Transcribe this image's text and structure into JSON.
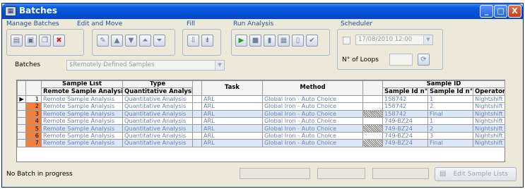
{
  "window": {
    "title": "Batches",
    "controls": [
      "_",
      "□",
      "X"
    ]
  },
  "toolbar": {
    "groups": [
      {
        "label": "Manage Batches",
        "icons": [
          "folder-open-icon",
          "save-icon",
          "copy-icon",
          "delete-icon"
        ]
      },
      {
        "label": "Edit and Move",
        "icons": [
          "edit-icon",
          "move-up-icon",
          "move-down-icon",
          "move-top-icon",
          "move-bottom-icon"
        ]
      },
      {
        "label": "Fill",
        "icons": [
          "fill-down-icon",
          "fill-series-icon"
        ]
      },
      {
        "label": "Run Analysis",
        "icons": [
          "play-icon",
          "stop-icon",
          "pause-icon",
          "multi-page-icon",
          "single-page-icon",
          "checkmark-icon"
        ]
      },
      {
        "label": "Scheduler"
      }
    ],
    "scheduler": {
      "datetime": "17/08/2010 12:00",
      "loops_label": "N° of Loops",
      "loops_value": ""
    }
  },
  "batches": {
    "label": "Batches",
    "value": "$Remotely Defined Samples"
  },
  "grid": {
    "headers": {
      "sample_list": "Sample List",
      "type": "Type",
      "task": "Task",
      "method": "Method",
      "sample_id": "Sample ID",
      "remote_sample_analysis": "Remote Sample Analysis",
      "quantitative_analysis": "Quantitative Analysis",
      "sample_id_n1": "Sample Id n°1",
      "sample_id_n2": "Sample Id n°2",
      "operator": "Operator"
    },
    "rows": [
      {
        "marker": "▶",
        "num": "1",
        "sample_list": "Remote Sample Analysis",
        "type": "Quantitative Analysis",
        "task": "ARL",
        "method": "Global Iron - Auto Choice",
        "hatch": false,
        "id1": "158742",
        "id2": "1",
        "operator": "Nightshift"
      },
      {
        "marker": "",
        "num": "2",
        "sample_list": "Remote Sample Analysis",
        "type": "Quantitative Analysis",
        "task": "ARL",
        "method": "Global Iron - Auto Choice",
        "hatch": false,
        "id1": "158742",
        "id2": "2",
        "operator": "Nightshift"
      },
      {
        "marker": "",
        "num": "3",
        "sample_list": "Remote Sample Analysis",
        "type": "Quantitative Analysis",
        "task": "ARL",
        "method": "Global Iron - Auto Choice",
        "hatch": true,
        "id1": "158742",
        "id2": "Final",
        "operator": "Nightshift"
      },
      {
        "marker": "",
        "num": "4",
        "sample_list": "Remote Sample Analysis",
        "type": "Quantitative Analysis",
        "task": "ARL",
        "method": "Global Iron - Auto Choice",
        "hatch": false,
        "id1": "749-BZ24",
        "id2": "1",
        "operator": "Nightshift"
      },
      {
        "marker": "",
        "num": "5",
        "sample_list": "Remote Sample Analysis",
        "type": "Quantitative Analysis",
        "task": "ARL",
        "method": "Global Iron - Auto Choice",
        "hatch": true,
        "id1": "749-BZ24",
        "id2": "2",
        "operator": "Nightshift"
      },
      {
        "marker": "",
        "num": "6",
        "sample_list": "Remote Sample Analysis",
        "type": "Quantitative Analysis",
        "task": "ARL",
        "method": "Global Iron - Auto Choice",
        "hatch": false,
        "id1": "749-BZ24",
        "id2": "3",
        "operator": "Nightshift"
      },
      {
        "marker": "",
        "num": "7",
        "sample_list": "Remote Sample Analysis",
        "type": "Quantitative Analysis",
        "task": "ARL",
        "method": "Global Iron - Auto Choice",
        "hatch": true,
        "id1": "749-BZ24",
        "id2": "Final",
        "operator": "Nightshift"
      }
    ]
  },
  "status": {
    "text": "No Batch in progress"
  },
  "footer": {
    "edit_sample_lists": "Edit Sample Lists"
  },
  "colors": {
    "titlebar": "#0550d6",
    "row_number": "#f08040",
    "alt_row": "#dbe7f6",
    "cell_text": "#6a84b0",
    "group_label": "#2050a0"
  }
}
